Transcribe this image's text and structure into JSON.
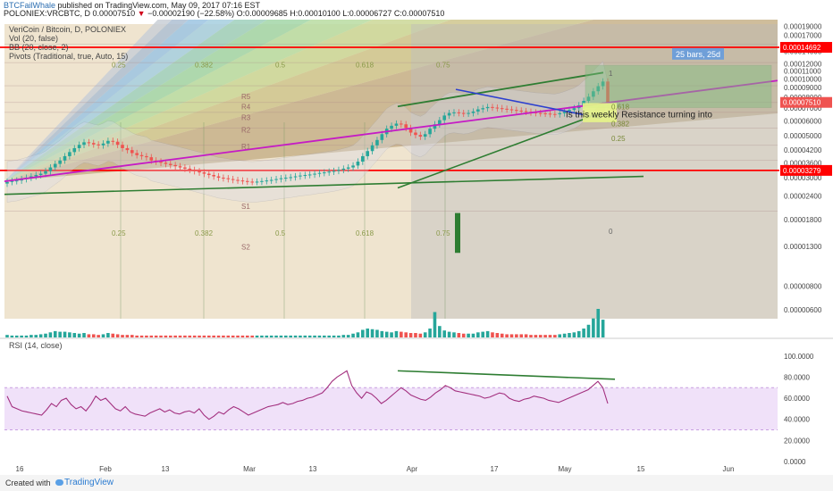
{
  "header": {
    "author": "BTCFailWhale",
    "published": "published on TradingView.com, May 09, 2017 07:16 EST",
    "symbol_line": "POLONIEX:VRCBTC, D",
    "last": "0.00007510",
    "change": "−0.00002190 (−22.58%)",
    "ohlc": "O:0.00009685 H:0.00010100 L:0.00006727 C:0.00007510"
  },
  "legend": {
    "title": "VeriCoin / Bitcoin, D, POLONIEX",
    "vol": "Vol (20, false)",
    "bb": "BB (20, close, 2)",
    "pivots": "Pivots (Traditional, true, Auto, 15)"
  },
  "rsi_label": "RSI (14, close)",
  "footer": {
    "created": "Created with",
    "brand": "TradingView"
  },
  "colors": {
    "up": "#26a69a",
    "down": "#ef5350",
    "resistance": "#ff0000",
    "trend": "#2e7d32",
    "channel": "#c51bc5",
    "wedge": "#2c3fcf",
    "rsi": "#a3307f",
    "rsi_band": "#e9d4f7"
  },
  "chart_data": {
    "type": "candlestick",
    "price_axis": {
      "scale": "log",
      "ticks": [
        "0.00019000",
        "0.00017000",
        "0.00014000",
        "0.00012000",
        "0.00011000",
        "0.00010000",
        "0.00009000",
        "0.00008000",
        "0.00007000",
        "0.00006000",
        "0.00005000",
        "0.00004200",
        "0.00003600",
        "0.00003000",
        "0.00002400",
        "0.00001800",
        "0.00001300",
        "0.00000800",
        "0.00000600"
      ]
    },
    "time_axis": {
      "ticks": [
        "16",
        "Feb",
        "13",
        "Mar",
        "13",
        "Apr",
        "17",
        "May",
        "15",
        "Jun"
      ]
    },
    "price_labels": [
      {
        "value": "0.00014692",
        "color": "#ff0000"
      },
      {
        "value": "0.00007510",
        "color": "#ef5350"
      },
      {
        "value": "0.00003279",
        "color": "#ff0000"
      }
    ],
    "horizontal_lines": [
      {
        "price": 0.00014692,
        "name": "resistance"
      },
      {
        "price": 3.279e-05,
        "name": "support"
      }
    ],
    "close": [
      2.85e-05,
      2.88e-05,
      2.9e-05,
      2.95e-05,
      3e-05,
      3.05e-05,
      3.1e-05,
      3.15e-05,
      3.25e-05,
      3.4e-05,
      3.55e-05,
      3.7e-05,
      3.9e-05,
      4.1e-05,
      4.3e-05,
      4.48e-05,
      4.62e-05,
      4.58e-05,
      4.5e-05,
      4.45e-05,
      4.55e-05,
      4.7e-05,
      4.65e-05,
      4.48e-05,
      4.3e-05,
      4.2e-05,
      4.05e-05,
      3.95e-05,
      3.9e-05,
      3.85e-05,
      3.7e-05,
      3.65e-05,
      3.6e-05,
      3.55e-05,
      3.5e-05,
      3.45e-05,
      3.4e-05,
      3.35e-05,
      3.3e-05,
      3.25e-05,
      3.2e-05,
      3.15e-05,
      3.1e-05,
      3.05e-05,
      3e-05,
      2.98e-05,
      2.95e-05,
      2.92e-05,
      2.9e-05,
      2.88e-05,
      2.86e-05,
      2.85e-05,
      2.86e-05,
      2.88e-05,
      2.9e-05,
      2.92e-05,
      2.95e-05,
      2.98e-05,
      3e-05,
      3.02e-05,
      3.05e-05,
      3.08e-05,
      3.1e-05,
      3.12e-05,
      3.15e-05,
      3.18e-05,
      3.2e-05,
      3.23e-05,
      3.26e-05,
      3.3e-05,
      3.35e-05,
      3.4e-05,
      3.48e-05,
      3.65e-05,
      3.9e-05,
      4.15e-05,
      4.45e-05,
      4.75e-05,
      5.1e-05,
      5.45e-05,
      5.65e-05,
      5.8e-05,
      5.75e-05,
      5.5e-05,
      5.2e-05,
      5.05e-05,
      4.95e-05,
      5.1e-05,
      5.45e-05,
      5.75e-05,
      6.05e-05,
      6.4e-05,
      6.6e-05,
      6.65e-05,
      6.6e-05,
      6.55e-05,
      6.6e-05,
      6.72e-05,
      6.9e-05,
      7e-05,
      7.1e-05,
      7.05e-05,
      7e-05,
      6.95e-05,
      6.9e-05,
      6.85e-05,
      6.8e-05,
      6.75e-05,
      6.7e-05,
      6.65e-05,
      6.6e-05,
      6.58e-05,
      6.55e-05,
      6.52e-05,
      6.5e-05,
      6.58e-05,
      6.7e-05,
      6.85e-05,
      7e-05,
      7.25e-05,
      7.65e-05,
      8.05e-05,
      8.6e-05,
      9.15e-05,
      9.685e-05,
      7.51e-05
    ],
    "volume": [
      4,
      3,
      3,
      3,
      3,
      4,
      4,
      5,
      6,
      8,
      10,
      9,
      9,
      8,
      7,
      6,
      7,
      5,
      5,
      4,
      5,
      7,
      6,
      5,
      4,
      4,
      4,
      3,
      3,
      3,
      3,
      3,
      3,
      3,
      3,
      3,
      3,
      3,
      3,
      3,
      3,
      3,
      3,
      3,
      3,
      3,
      3,
      3,
      3,
      3,
      3,
      3,
      3,
      3,
      3,
      3,
      3,
      3,
      3,
      3,
      3,
      3,
      3,
      3,
      3,
      3,
      3,
      3,
      3,
      3,
      4,
      4,
      6,
      8,
      12,
      14,
      13,
      12,
      10,
      9,
      8,
      10,
      9,
      8,
      7,
      7,
      6,
      8,
      14,
      40,
      18,
      11,
      9,
      8,
      7,
      6,
      6,
      6,
      8,
      9,
      10,
      8,
      7,
      6,
      5,
      5,
      5,
      5,
      5,
      4,
      4,
      4,
      4,
      4,
      4,
      5,
      6,
      7,
      8,
      10,
      14,
      20,
      30,
      45,
      28
    ],
    "rsi": [
      62,
      52,
      50,
      48,
      47,
      46,
      45,
      44,
      49,
      55,
      52,
      58,
      60,
      54,
      50,
      52,
      48,
      54,
      62,
      58,
      60,
      55,
      50,
      48,
      52,
      47,
      45,
      44,
      43,
      46,
      48,
      50,
      47,
      49,
      46,
      45,
      47,
      48,
      46,
      50,
      44,
      40,
      43,
      47,
      45,
      49,
      52,
      50,
      47,
      44,
      46,
      48,
      50,
      52,
      53,
      54,
      56,
      54,
      55,
      57,
      58,
      60,
      61,
      63,
      65,
      70,
      76,
      80,
      83,
      86,
      72,
      65,
      60,
      66,
      64,
      60,
      55,
      58,
      62,
      66,
      70,
      67,
      63,
      61,
      59,
      58,
      61,
      65,
      68,
      72,
      70,
      67,
      66,
      65,
      64,
      63,
      62,
      60,
      61,
      63,
      65,
      64,
      60,
      58,
      57,
      59,
      60,
      62,
      61,
      60,
      58,
      57,
      56,
      58,
      60,
      62,
      64,
      66,
      68,
      72,
      76,
      70,
      55
    ],
    "rsi_axis": {
      "ticks": [
        "100.0000",
        "80.0000",
        "60.0000",
        "40.0000",
        "20.0000",
        "0.0000"
      ],
      "bands": [
        30,
        70
      ]
    },
    "fib_labels": {
      "fan_top": [
        "0.25",
        "0.382",
        "0.5",
        "0.618",
        "0.75"
      ],
      "fan_bottom": [
        "0.25",
        "0.382",
        "0.5",
        "0.618",
        "0.75"
      ],
      "zero": "0",
      "one": "1",
      "right_fib": [
        "0.618",
        "0.382",
        "0.25"
      ]
    },
    "pivot_labels": [
      "R5",
      "R4",
      "R3",
      "R2",
      "R1",
      "S1",
      "S2"
    ],
    "measure_box": {
      "label": "25 bars, 25d"
    },
    "annotation": "Is this weekly Resistance turning into"
  }
}
